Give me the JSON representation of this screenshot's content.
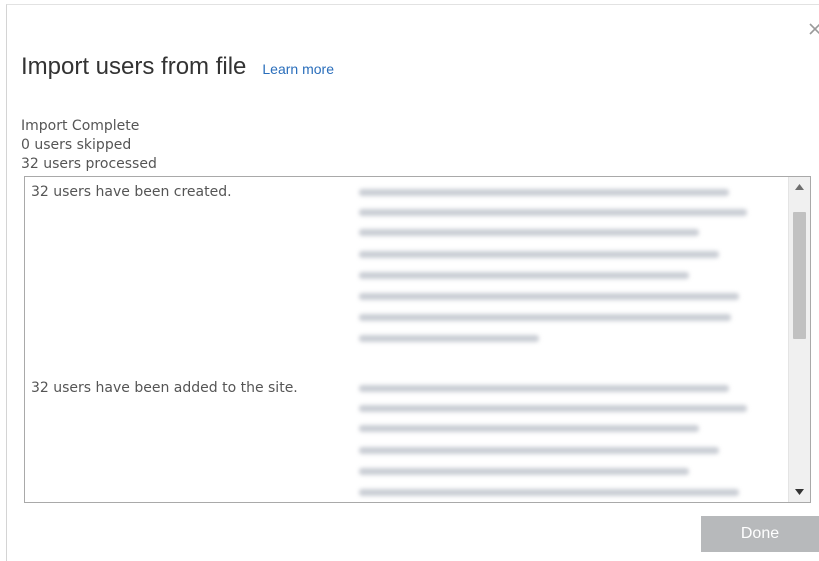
{
  "dialog": {
    "title": "Import users from file",
    "learn_more": "Learn more",
    "close_icon": "close-icon"
  },
  "status": {
    "heading": "Import Complete",
    "skipped": "0 users skipped",
    "processed": "32 users processed"
  },
  "results": [
    {
      "label": "32 users have been created."
    },
    {
      "label": "32 users have been added to the site."
    }
  ],
  "scrollbar": {
    "up_icon": "arrow-up-icon",
    "down_icon": "arrow-down-icon"
  },
  "footer": {
    "done_label": "Done"
  },
  "colors": {
    "link": "#2a6ebb",
    "button_disabled": "#b7b9bb",
    "text": "#555555"
  }
}
